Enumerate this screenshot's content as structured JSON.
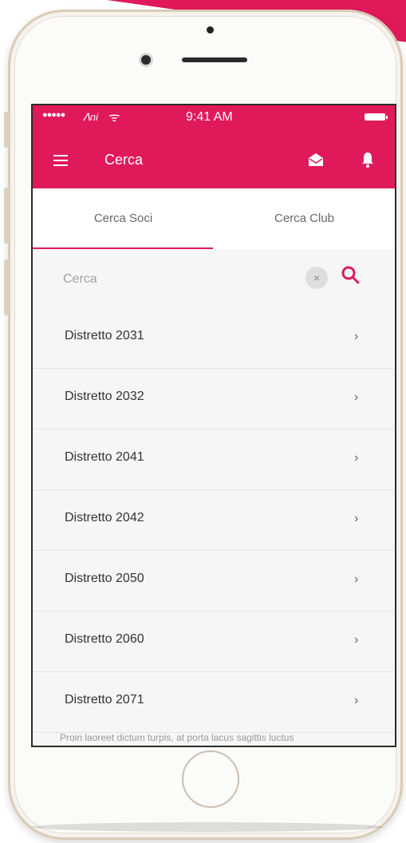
{
  "status_bar": {
    "signal": "●●●●●",
    "carrier": "ᐱni",
    "wifi": "ᯤ",
    "time": "9:41 AM"
  },
  "header": {
    "title": "Cerca"
  },
  "tabs": [
    {
      "label": "Cerca Soci",
      "active": true
    },
    {
      "label": "Cerca Club",
      "active": false
    }
  ],
  "search": {
    "placeholder": "Cerca",
    "value": "",
    "clear_glyph": "×"
  },
  "list": {
    "items": [
      {
        "label": "Distretto 2031"
      },
      {
        "label": "Distretto 2032"
      },
      {
        "label": "Distretto 2041"
      },
      {
        "label": "Distretto 2042"
      },
      {
        "label": "Distretto 2050"
      },
      {
        "label": "Distretto 2060"
      },
      {
        "label": "Distretto 2071"
      }
    ],
    "chevron": "›"
  },
  "cutoff_text": "Proin laoreet dictum turpis, at porta lacus sagittis luctus",
  "colors": {
    "accent": "#e0195a",
    "background": "#f6f6f6"
  },
  "icons": [
    "menu-icon",
    "mail-icon",
    "bell-icon",
    "search-icon",
    "clear-icon",
    "chevron-right-icon"
  ]
}
